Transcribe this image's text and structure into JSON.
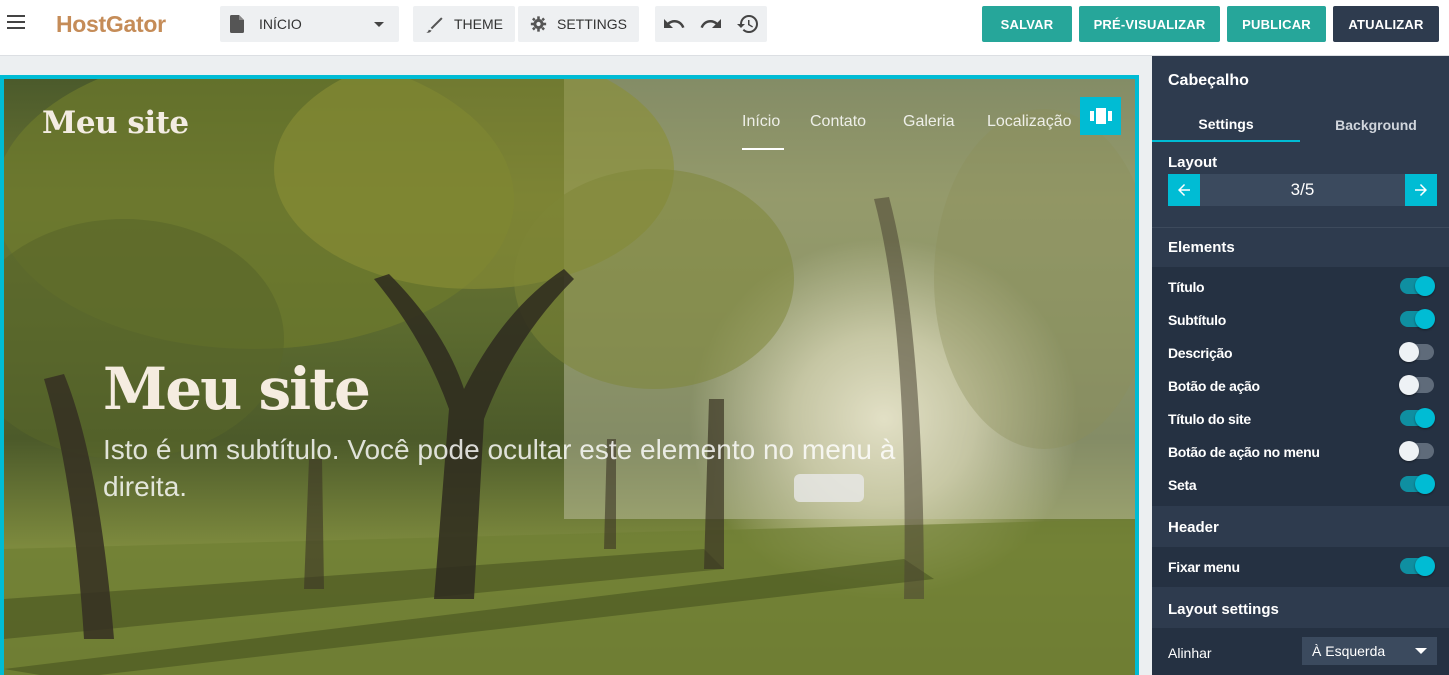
{
  "app": {
    "logo": "HostGator"
  },
  "toolbar": {
    "page_select": "INÍCIO",
    "theme_label": "THEME",
    "settings_label": "SETTINGS",
    "salvar_label": "SALVAR",
    "preview_label": "PRÉ-VISUALIZAR",
    "publicar_label": "PUBLICAR",
    "atualizar_label": "ATUALIZAR"
  },
  "site": {
    "brand": "Meu site",
    "nav": [
      "Início",
      "Contato",
      "Galeria",
      "Localização"
    ],
    "hero_title": "Meu site",
    "hero_subtitle": "Isto é um subtítulo. Você pode ocultar este elemento no menu à direita."
  },
  "panel": {
    "title": "Cabeçalho",
    "tabs": [
      "Settings",
      "Background"
    ],
    "active_tab": "Settings",
    "layout_label": "Layout",
    "layout_value": "3/5",
    "elements_header": "Elements",
    "elements": [
      {
        "label": "Título",
        "on": true
      },
      {
        "label": "Subtítulo",
        "on": true
      },
      {
        "label": "Descrição",
        "on": false
      },
      {
        "label": "Botão de ação",
        "on": false
      },
      {
        "label": "Título do site",
        "on": true
      },
      {
        "label": "Botão de ação no menu",
        "on": false
      },
      {
        "label": "Seta",
        "on": true
      }
    ],
    "header_header": "Header",
    "header_items": [
      {
        "label": "Fixar menu",
        "on": true
      }
    ],
    "layout_settings_header": "Layout settings",
    "align_label": "Alinhar",
    "align_value": "À Esquerda"
  },
  "colors": {
    "accent": "#00bcd4",
    "teal_button": "#26a69a",
    "dark_button": "#2e3b4e",
    "panel_bg": "#2e3b4e",
    "logo": "#c58c58"
  }
}
